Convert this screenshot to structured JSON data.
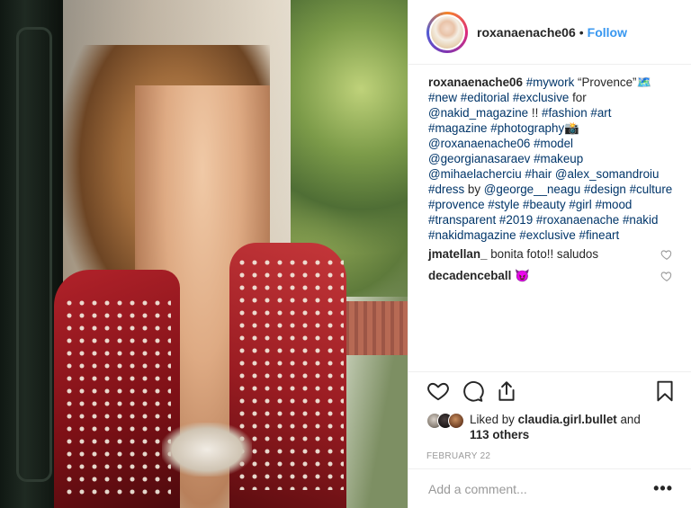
{
  "post": {
    "username": "roxanaenache06",
    "separator": "•",
    "follow_label": "Follow",
    "photo_alt": "Post photo",
    "caption": {
      "username": "roxanaenache06",
      "segments": [
        {
          "t": " "
        },
        {
          "t": "#mywork",
          "tag": true
        },
        {
          "t": " “Provence”🗺️ "
        },
        {
          "t": "#new",
          "tag": true
        },
        {
          "t": " "
        },
        {
          "t": "#editorial",
          "tag": true
        },
        {
          "t": " "
        },
        {
          "t": "#exclusive",
          "tag": true
        },
        {
          "t": " for "
        },
        {
          "t": "@nakid_magazine",
          "tag": true
        },
        {
          "t": " !! "
        },
        {
          "t": "#fashion",
          "tag": true
        },
        {
          "t": " "
        },
        {
          "t": "#art",
          "tag": true
        },
        {
          "t": " "
        },
        {
          "t": "#magazine",
          "tag": true
        },
        {
          "t": " "
        },
        {
          "t": "#photography",
          "tag": true
        },
        {
          "t": "📸 "
        },
        {
          "t": "@roxanaenache06",
          "tag": true
        },
        {
          "t": " "
        },
        {
          "t": "#model",
          "tag": true
        },
        {
          "t": " "
        },
        {
          "t": "@georgianasaraev",
          "tag": true
        },
        {
          "t": " "
        },
        {
          "t": "#makeup",
          "tag": true
        },
        {
          "t": " "
        },
        {
          "t": "@mihaelacherciu",
          "tag": true
        },
        {
          "t": " "
        },
        {
          "t": "#hair",
          "tag": true
        },
        {
          "t": " "
        },
        {
          "t": "@alex_somandroiu",
          "tag": true
        },
        {
          "t": " "
        },
        {
          "t": "#dress",
          "tag": true
        },
        {
          "t": " by "
        },
        {
          "t": "@george__neagu",
          "tag": true
        },
        {
          "t": " "
        },
        {
          "t": "#design",
          "tag": true
        },
        {
          "t": " "
        },
        {
          "t": "#culture",
          "tag": true
        },
        {
          "t": " "
        },
        {
          "t": "#provence",
          "tag": true
        },
        {
          "t": " "
        },
        {
          "t": "#style",
          "tag": true
        },
        {
          "t": " "
        },
        {
          "t": "#beauty",
          "tag": true
        },
        {
          "t": " "
        },
        {
          "t": "#girl",
          "tag": true
        },
        {
          "t": " "
        },
        {
          "t": "#mood",
          "tag": true
        },
        {
          "t": " "
        },
        {
          "t": "#transparent",
          "tag": true
        },
        {
          "t": " "
        },
        {
          "t": "#2019",
          "tag": true
        },
        {
          "t": " "
        },
        {
          "t": "#roxanaenache",
          "tag": true
        },
        {
          "t": " "
        },
        {
          "t": "#nakid",
          "tag": true
        },
        {
          "t": " "
        },
        {
          "t": "#nakidmagazine",
          "tag": true
        },
        {
          "t": " "
        },
        {
          "t": "#exclusive",
          "tag": true
        },
        {
          "t": " "
        },
        {
          "t": "#fineart",
          "tag": true
        }
      ]
    },
    "comments": [
      {
        "username": "jmatellan_",
        "text": " bonita foto!! saludos"
      },
      {
        "username": "decadenceball",
        "text": " 😈"
      }
    ],
    "likes": {
      "prefix": "Liked by ",
      "user": "claudia.girl.bullet",
      "and": " and",
      "others": "113 others"
    },
    "date": "FEBRUARY 22",
    "add_comment_placeholder": "Add a comment...",
    "more_label": "•••",
    "icons": {
      "like": "heart-icon",
      "comment": "comment-bubble-icon",
      "share": "share-icon",
      "save": "bookmark-icon"
    },
    "colors": {
      "link": "#003569",
      "follow": "#3897f0",
      "text": "#262626",
      "muted": "#999999"
    }
  }
}
